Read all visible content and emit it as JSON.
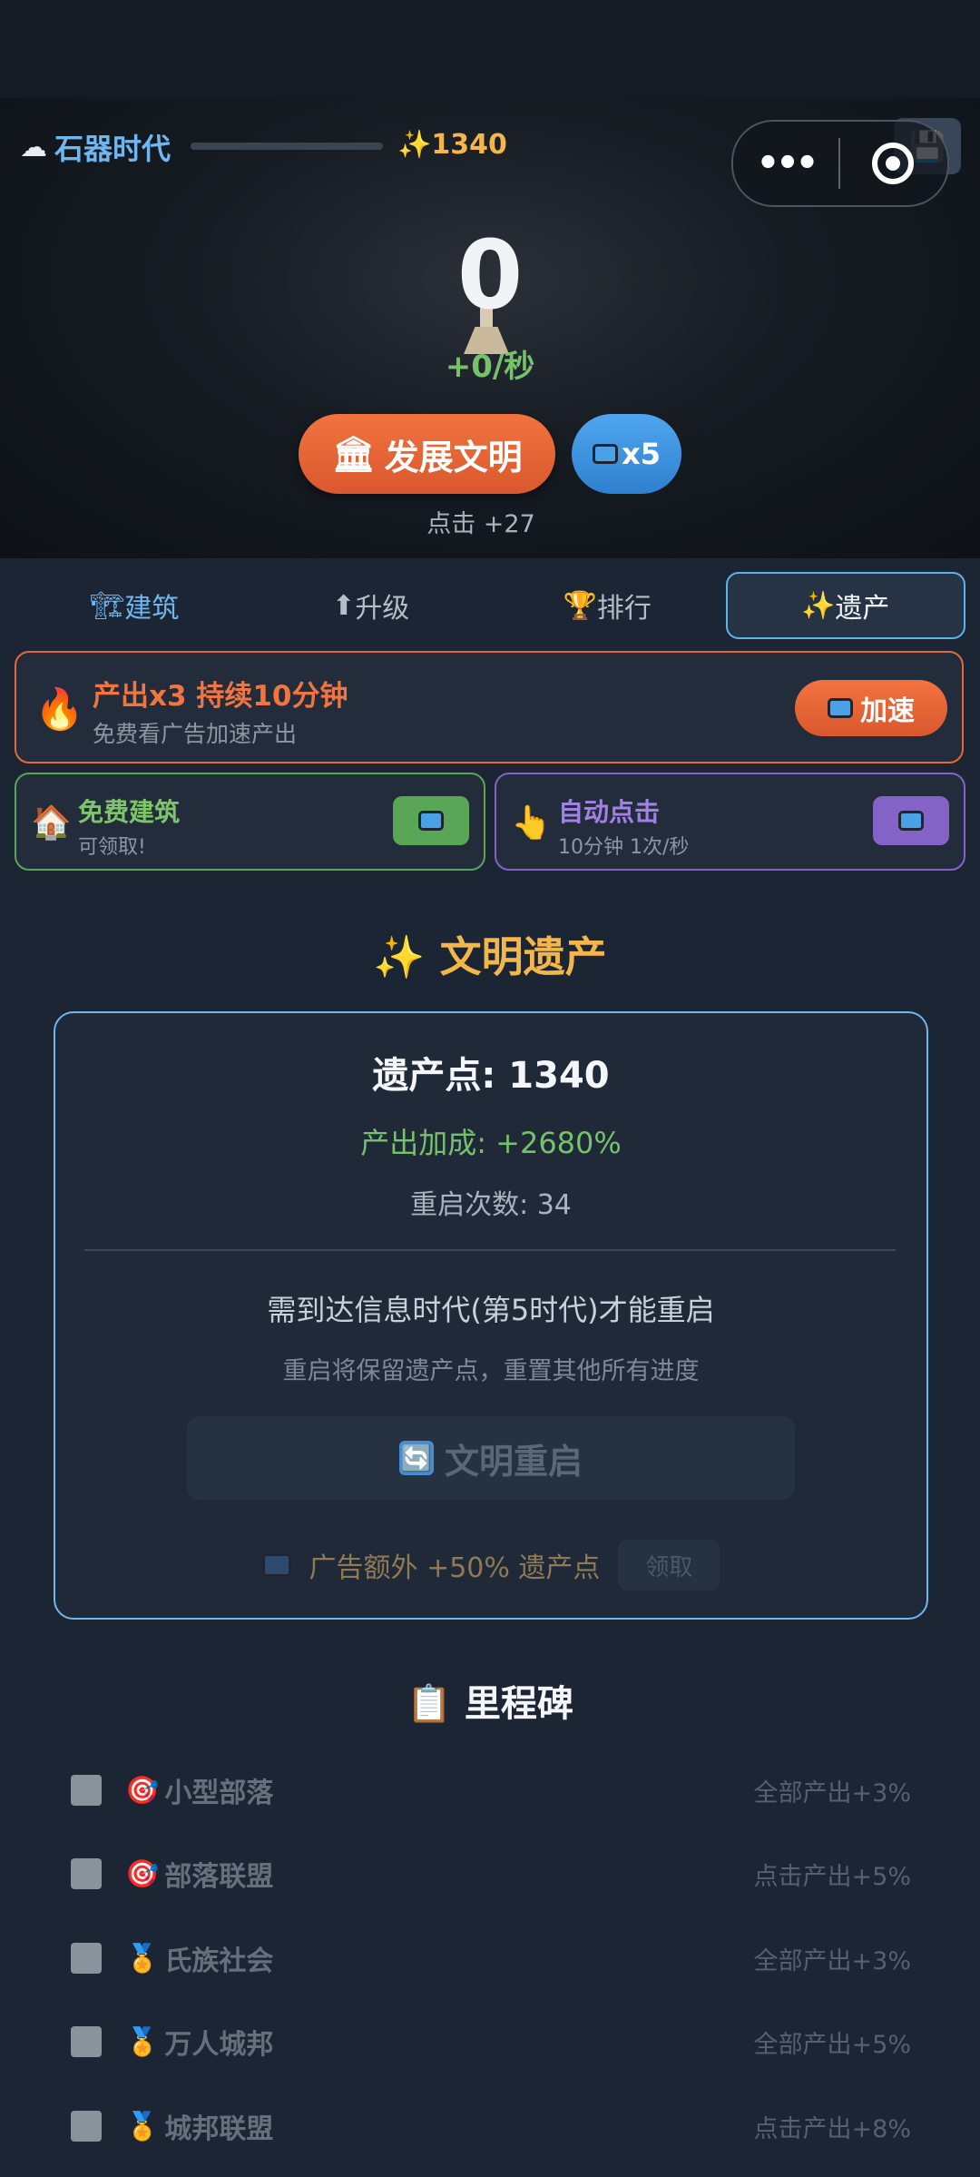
{
  "header": {
    "era_icon": "☁",
    "era_name": "石器时代",
    "era_progress": 0,
    "legacy_points_icon": "✨",
    "legacy_points": "1340",
    "save_icon": "💾",
    "capsule_more_icon": "•••",
    "capsule_target_icon": "target-icon"
  },
  "hero": {
    "count": "0",
    "rate": "+0/秒",
    "develop_icon": "🏛",
    "develop_label": "发展文明",
    "ad_multiplier": "x5",
    "click_info": "点击 +27"
  },
  "tabs": [
    {
      "icon": "🏗",
      "label": "建筑"
    },
    {
      "icon": "⬆",
      "label": "升级"
    },
    {
      "icon": "🏆",
      "label": "排行"
    },
    {
      "icon": "✨",
      "label": "遗产"
    }
  ],
  "boost": {
    "icon": "🔥",
    "title": "产出x3 持续10分钟",
    "subtitle": "免费看广告加速产出",
    "button_label": "加速"
  },
  "free_building": {
    "icon": "🏠",
    "title": "免费建筑",
    "subtitle": "可领取!"
  },
  "auto_click": {
    "icon": "👆",
    "title": "自动点击",
    "subtitle": "10分钟 1次/秒"
  },
  "legacy": {
    "title": "✨ 文明遗产",
    "points_text": "遗产点: 1340",
    "bonus_text": "产出加成: +2680%",
    "resets_text": "重启次数: 34",
    "requirement": "需到达信息时代(第5时代)才能重启",
    "note": "重启将保留遗产点，重置其他所有进度",
    "restart_icon": "🔄",
    "restart_label": "文明重启",
    "ad_extra_text": "广告额外 +50% 遗产点",
    "claim_label": "领取"
  },
  "milestones": {
    "title": "📋 里程碑",
    "items": [
      {
        "icon": "🎯",
        "name": "小型部落",
        "effect": "全部产出+3%"
      },
      {
        "icon": "🎯",
        "name": "部落联盟",
        "effect": "点击产出+5%"
      },
      {
        "icon": "🏅",
        "name": "氏族社会",
        "effect": "全部产出+3%"
      },
      {
        "icon": "🏅",
        "name": "万人城邦",
        "effect": "全部产出+5%"
      },
      {
        "icon": "🏅",
        "name": "城邦联盟",
        "effect": "点击产出+8%"
      }
    ]
  },
  "colors": {
    "accent_blue": "#6fb7ee",
    "accent_orange": "#f07542",
    "accent_gold": "#f2b64a",
    "accent_green": "#76c16b",
    "accent_purple": "#8463c7"
  }
}
